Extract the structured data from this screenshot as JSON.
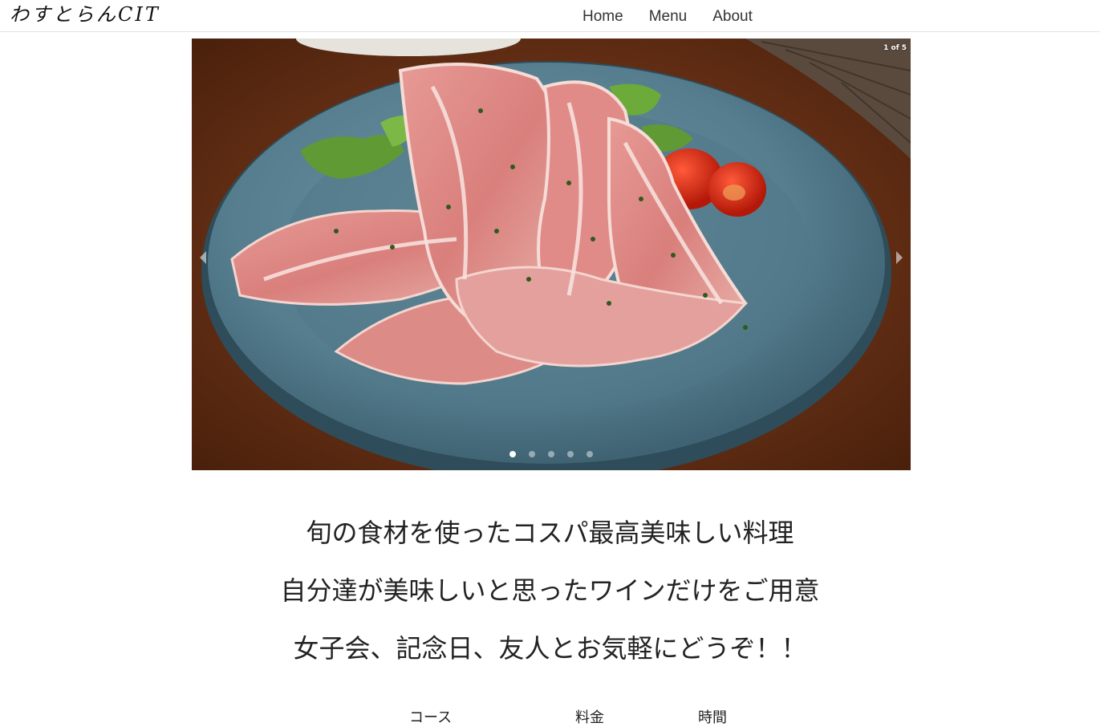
{
  "header": {
    "logo": "わすとらんCIT",
    "nav": [
      "Home",
      "Menu",
      "About"
    ]
  },
  "carousel": {
    "counter": "1 of 5",
    "slide_count": 5,
    "active_index": 0,
    "image_subject": "prosciutto-plate"
  },
  "intro": {
    "lines": [
      "旬の食材を使ったコスパ最高美味しい料理",
      "自分達が美味しいと思ったワインだけをご用意",
      "女子会、記念日、友人とお気軽にどうぞ！！"
    ]
  },
  "info": {
    "headers": [
      "コース",
      "料金",
      "時間"
    ]
  }
}
